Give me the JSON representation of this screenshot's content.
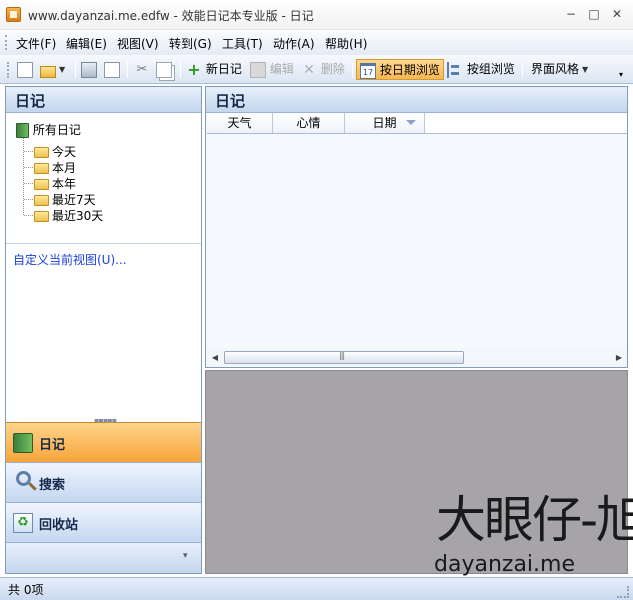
{
  "window": {
    "title": "www.dayanzai.me.edfw - 效能日记本专业版 - 日记",
    "minimize": "−",
    "maximize": "□",
    "close": "✕"
  },
  "menu": [
    "文件(F)",
    "编辑(E)",
    "视图(V)",
    "转到(G)",
    "工具(T)",
    "动作(A)",
    "帮助(H)"
  ],
  "toolbar": {
    "new_diary": "新日记",
    "edit": "编辑",
    "delete": "删除",
    "by_date": "按日期浏览",
    "by_group": "按组浏览",
    "ui_style": "界面风格",
    "calendar_glyph": "17"
  },
  "left_panel": {
    "title": "日记",
    "tree_root": "所有日记",
    "tree_items": [
      "今天",
      "本月",
      "本年",
      "最近7天",
      "最近30天"
    ],
    "custom_view_link": "自定义当前视图(U)..."
  },
  "nav": {
    "diary": "日记",
    "search": "搜索",
    "recycle": "回收站"
  },
  "list": {
    "title": "日记",
    "columns": [
      "天气",
      "心情",
      "日期"
    ]
  },
  "watermark": {
    "top": "大眼仔-旭",
    "bottom": "dayanzai.me"
  },
  "status": {
    "count": "共 0项"
  },
  "colors": {
    "selected_nav": "#f8a43b",
    "preview_bg": "#a6a4a8",
    "link": "#1a3fd6"
  }
}
